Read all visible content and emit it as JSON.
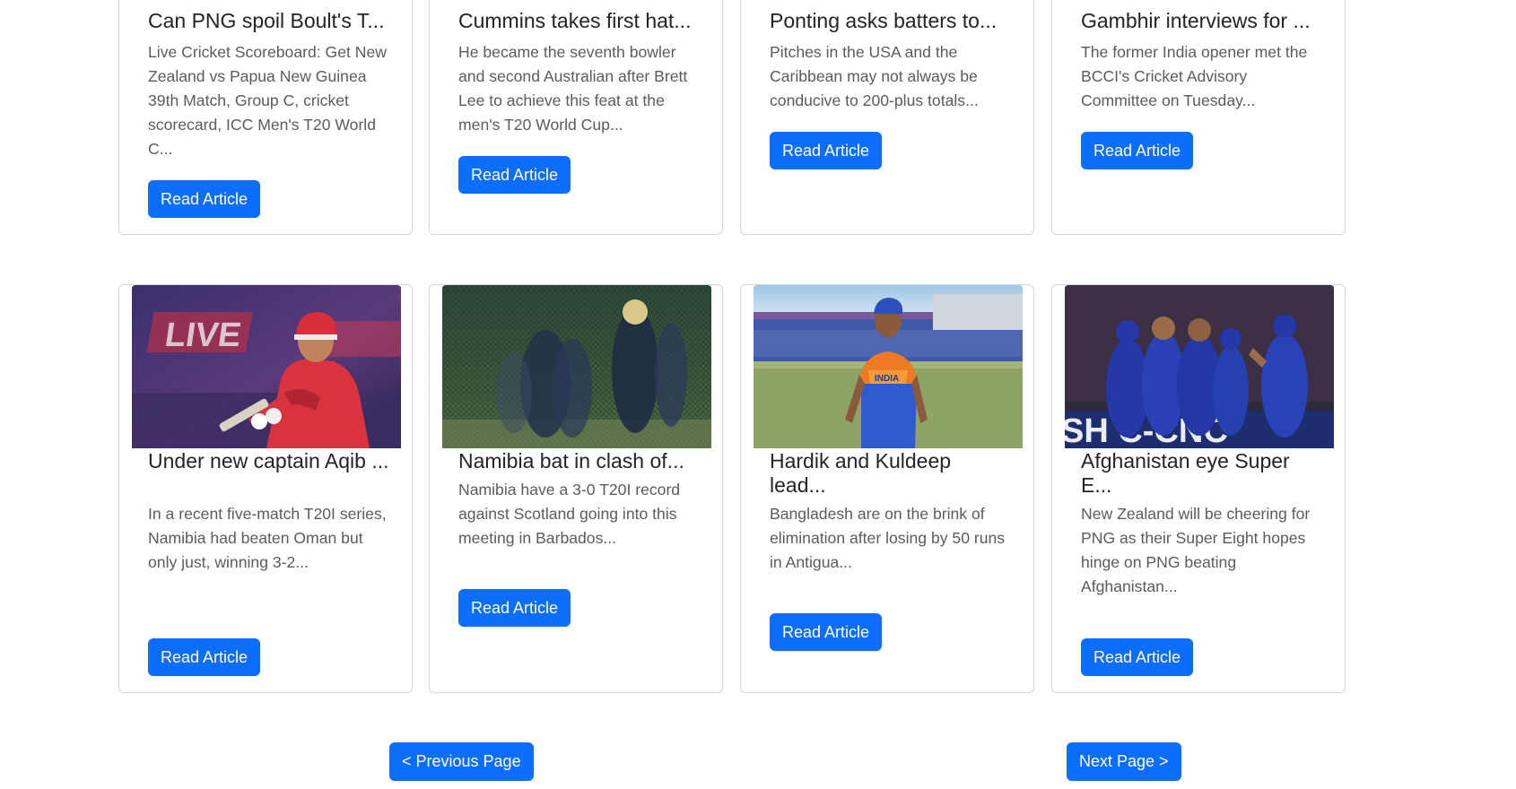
{
  "articles_top": [
    {
      "title": "Can PNG spoil Boult's T...",
      "description": "Live Cricket Scoreboard: Get New Zealand vs Papua New Guinea 39th Match, Group C, cricket scorecard, ICC Men's T20 World C...",
      "button_label": "Read Article"
    },
    {
      "title": "Cummins takes first hat...",
      "description": "He became the seventh bowler and second Australian after Brett Lee to achieve this feat at the men's T20 World Cup...",
      "button_label": "Read Article"
    },
    {
      "title": "Ponting asks batters to...",
      "description": "Pitches in the USA and the Caribbean may not always be conducive to 200-plus totals...",
      "button_label": "Read Article"
    },
    {
      "title": "Gambhir interviews for ...",
      "description": "The former India opener met the BCCI's Cricket Advisory Committee on Tuesday...",
      "button_label": "Read Article"
    }
  ],
  "articles_bottom": [
    {
      "title": "Under new captain Aqib ...",
      "description": "In a recent five-match T20I series, Namibia had beaten Oman but only just, winning 3-2...",
      "button_label": "Read Article",
      "image_overlay_text": "LIVE"
    },
    {
      "title": "Namibia bat in clash of...",
      "description": "Namibia have a 3-0 T20I record against Scotland going into this meeting in Barbados...",
      "button_label": "Read Article"
    },
    {
      "title": "Hardik and Kuldeep lead...",
      "description": "Bangladesh are on the brink of elimination after losing by 50 runs in Antigua...",
      "button_label": "Read Article",
      "image_overlay_text": "INDIA"
    },
    {
      "title": "Afghanistan eye Super E...",
      "description": "New Zealand will be cheering for PNG as their Super Eight hopes hinge on PNG beating Afghanistan...",
      "button_label": "Read Article",
      "image_overlay_text": "SH C-CNC"
    }
  ],
  "pagination": {
    "previous_label": "< Previous Page",
    "next_label": "Next Page >"
  },
  "colors": {
    "primary_button": "#0d6efd",
    "card_border": "#d4d6d9",
    "text_muted": "#595c5f"
  }
}
